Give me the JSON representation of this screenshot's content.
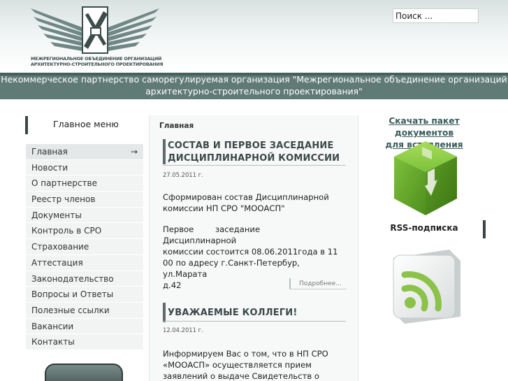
{
  "header": {
    "logo_line1": "МЕЖРЕГИОНАЛЬНОЕ ОБЪЕДИНЕНИЕ ОРГАНИЗАЦИЙ",
    "logo_line2": "АРХИТЕКТУРНО-СТРОИТЕЛЬНОГО ПРОЕКТИРОВАНИЯ",
    "search_value": "Поиск ...",
    "banner_line1": "Некоммерческое партнерство саморегулируемая организация \"Межрегиональное объединение организаций",
    "banner_line2": "архитектурно-строительного проектирования\""
  },
  "sidebar": {
    "title": "Главное меню",
    "items": [
      {
        "label": "Главная",
        "active": true
      },
      {
        "label": "Новости"
      },
      {
        "label": "О партнерстве"
      },
      {
        "label": "Реестр членов"
      },
      {
        "label": "Документы"
      },
      {
        "label": "Контроль в СРО"
      },
      {
        "label": "Страхование"
      },
      {
        "label": "Аттестация"
      },
      {
        "label": "Законодательство"
      },
      {
        "label": "Вопросы и Ответы"
      },
      {
        "label": "Полезные ссылки"
      },
      {
        "label": "Вакансии"
      },
      {
        "label": "Контакты"
      }
    ],
    "active_arrow": "→"
  },
  "main": {
    "breadcrumb": "Главная",
    "articles": [
      {
        "title_line1": "СОСТАВ И ПЕРВОЕ ЗАСЕДАНИЕ",
        "title_line2": "ДИСЦИПЛИНАРНОЙ КОМИССИИ",
        "date": "27.05.2011 г.",
        "para1_line1": "Сформирован состав Дисциплинарной",
        "para1_line2": "комиссии НП СРО \"МООАСП\"",
        "para2_line1": "Первое заседание Дисциплинарной",
        "para2_line2": "комиссии состоится 08.06.2011года в 11",
        "para2_line3": "00 по адресу г.Санкт-Петербур, ул.Марата",
        "para2_line4": "д.42",
        "more": "Подробнее..."
      },
      {
        "title_line1": "УВАЖАЕМЫЕ КОЛЛЕГИ!",
        "date": "12.04.2011 г.",
        "para1_line1": "Информируем Вас о том, что в НП СРО",
        "para1_line2": "«МООАСП» осуществляется прием",
        "para1_line3": "заявлений о выдаче Свидетельств о"
      }
    ]
  },
  "right": {
    "download_line1": "Скачать пакет документов",
    "download_line2": "для вступления",
    "rss_title": "RSS-подписка"
  },
  "colors": {
    "banner": "#607a76",
    "box_green": "#6dae2c",
    "link": "#3a5b5b"
  }
}
